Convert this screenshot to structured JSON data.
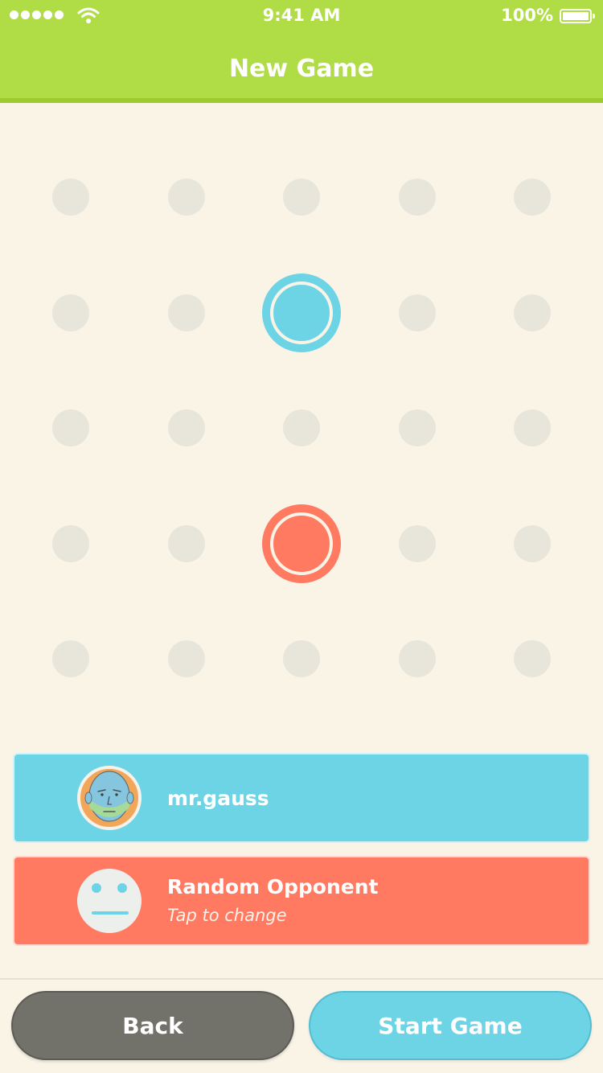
{
  "status_bar": {
    "time": "9:41 AM",
    "battery_percent": "100%",
    "signal_bars": 5,
    "icons": [
      "signal-dots-icon",
      "wifi-icon",
      "battery-icon"
    ]
  },
  "header": {
    "title": "New Game"
  },
  "board": {
    "rows": 5,
    "cols": 5,
    "empty_color": "#e8e5da",
    "pieces": [
      {
        "player": "player1",
        "row": 1,
        "col": 2,
        "color": "#6dd4e6"
      },
      {
        "player": "player2",
        "row": 3,
        "col": 2,
        "color": "#ff7a60"
      }
    ]
  },
  "players": {
    "player1": {
      "name": "mr.gauss",
      "color": "#6dd4e6",
      "avatar": "bald-man-avatar"
    },
    "player2": {
      "name": "Random Opponent",
      "subtitle": "Tap to change",
      "color": "#ff7a60",
      "avatar": "blank-face-avatar"
    }
  },
  "buttons": {
    "back": "Back",
    "start": "Start Game"
  },
  "colors": {
    "header": "#b0dd46",
    "background": "#faf4e7",
    "back_button": "#72716a",
    "start_button": "#6dd4e6"
  }
}
